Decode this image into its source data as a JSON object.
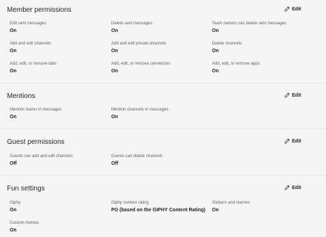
{
  "edit_label": "Edit",
  "icons": {
    "edit": "pencil-icon"
  },
  "colors": {
    "background": "#f5f5f5",
    "text": "#242424",
    "label": "#616161",
    "divider": "#e6e6e6"
  },
  "sections": [
    {
      "title": "Member permissions",
      "settings": [
        {
          "label": "Edit sent messages",
          "value": "On"
        },
        {
          "label": "Delete sent messages",
          "value": "On"
        },
        {
          "label": "Team owners can delete sent messages",
          "value": "On"
        },
        {
          "label": "Add and edit channels",
          "value": "On"
        },
        {
          "label": "Add and edit private channels",
          "value": "On"
        },
        {
          "label": "Delete channels",
          "value": "On"
        },
        {
          "label": "Add, edit, or remove tabs",
          "value": "On"
        },
        {
          "label": "Add, edit, or remove connectors",
          "value": "On"
        },
        {
          "label": "Add, edit, or remove apps",
          "value": "On"
        }
      ]
    },
    {
      "title": "Mentions",
      "settings": [
        {
          "label": "Mention teams in messages",
          "value": "On"
        },
        {
          "label": "Mention channels in messages",
          "value": "On"
        }
      ]
    },
    {
      "title": "Guest permissions",
      "settings": [
        {
          "label": "Guests can add and edit channels",
          "value": "Off"
        },
        {
          "label": "Guests can delete channels",
          "value": "Off"
        }
      ]
    },
    {
      "title": "Fun settings",
      "settings": [
        {
          "label": "Giphy",
          "value": "On"
        },
        {
          "label": "Giphy content rating",
          "value": "PG (based on the GIPHY Content Rating)"
        },
        {
          "label": "Stickers and memes",
          "value": "On"
        },
        {
          "label": "Custom memes",
          "value": "On"
        }
      ]
    }
  ]
}
